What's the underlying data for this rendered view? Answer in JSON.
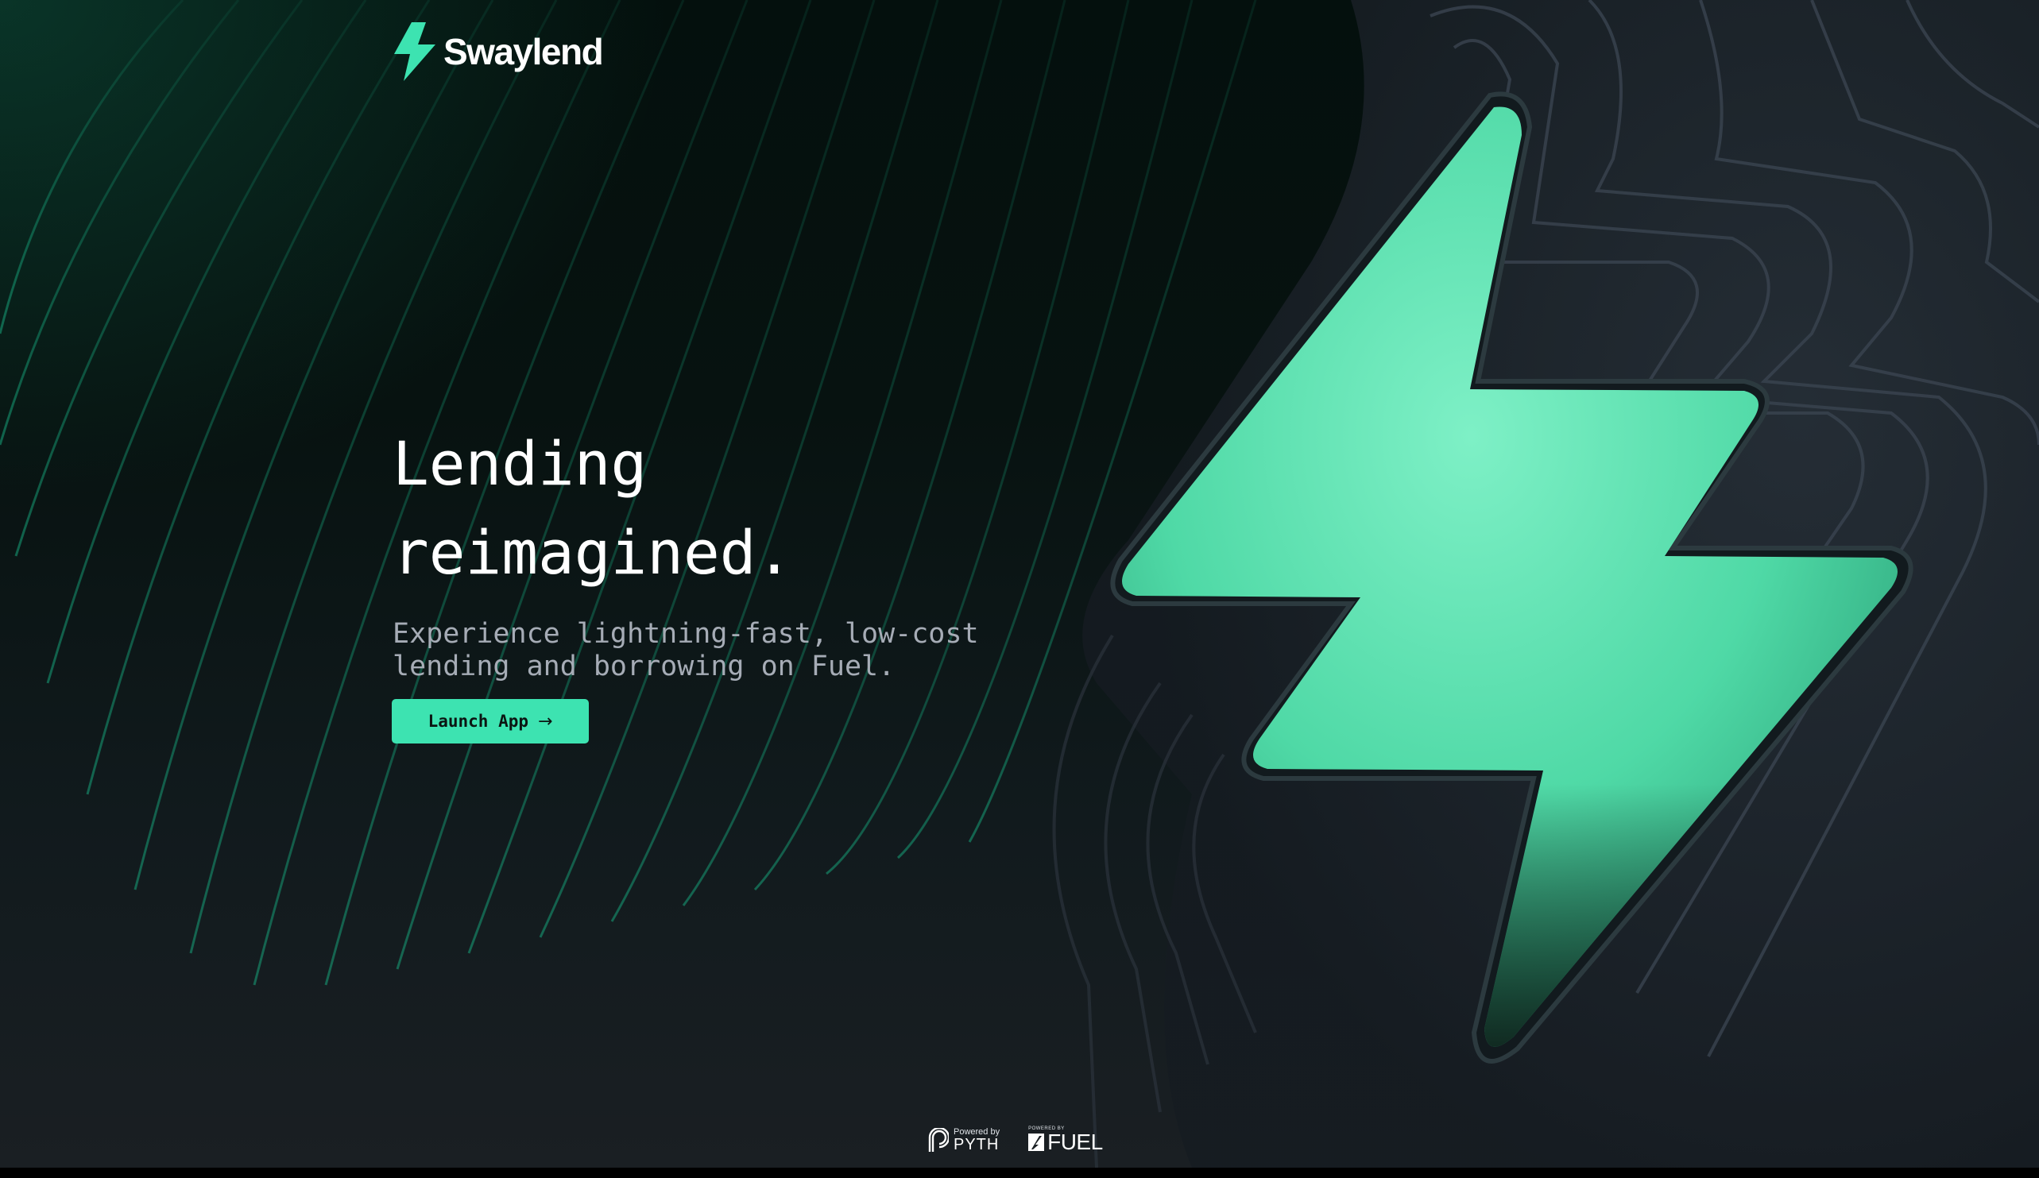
{
  "brand": {
    "name": "Swaylend",
    "accent_color": "#3de3b1",
    "logo_icon": "lightning-bolt-icon"
  },
  "hero": {
    "title": "Lending\nreimagined.",
    "subtitle": "Experience lightning-fast, low-cost lending and borrowing on Fuel.",
    "cta_label": "Launch App",
    "cta_icon": "arrow-right-icon",
    "cta_arrow": "→"
  },
  "footer": {
    "partners": [
      {
        "prefix": "Powered by",
        "name": "PYTH",
        "icon": "pyth-logo-icon"
      },
      {
        "prefix": "POWERED BY",
        "name": "FUEL",
        "icon": "fuel-logo-icon"
      }
    ]
  },
  "illustration": {
    "icon": "lightning-bolt-icon",
    "color": "#5ae3b0",
    "background_color": "#1c232b"
  }
}
